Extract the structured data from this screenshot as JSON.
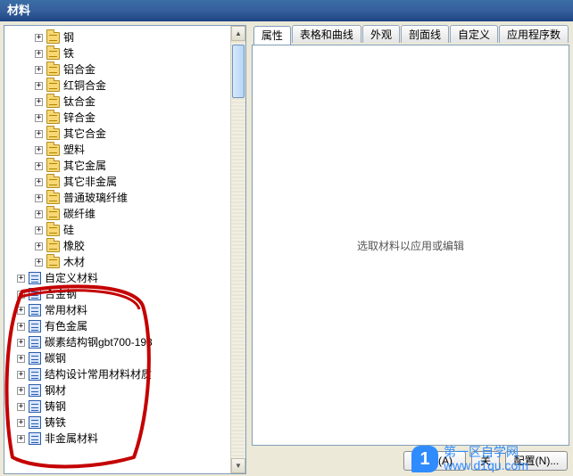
{
  "window": {
    "title": "材料"
  },
  "tree": {
    "folder_items": [
      "钢",
      "铁",
      "铝合金",
      "红铜合金",
      "钛合金",
      "锌合金",
      "其它合金",
      "塑料",
      "其它金属",
      "其它非金属",
      "普通玻璃纤维",
      "碳纤维",
      "硅",
      "橡胶",
      "木材"
    ],
    "doc_items": [
      "自定义材料",
      "合金钢",
      "常用材料",
      "有色金属",
      "碳素结构钢gbt700-198",
      "碳钢",
      "结构设计常用材料材质",
      "钢材",
      "铸钢",
      "铸铁",
      "非金属材料"
    ]
  },
  "scrollbar": {
    "up": "▲",
    "down": "▼"
  },
  "tabs": {
    "items": [
      "属性",
      "表格和曲线",
      "外观",
      "剖面线",
      "自定义",
      "应用程序数"
    ]
  },
  "pane": {
    "placeholder": "选取材料以应用或编辑"
  },
  "buttons": {
    "apply": "应用(A)",
    "close": "关",
    "configure": "配置(N)..."
  },
  "watermark": {
    "badge": "1",
    "line1": "第一区自学网",
    "line2": "www.d1qu.com"
  }
}
